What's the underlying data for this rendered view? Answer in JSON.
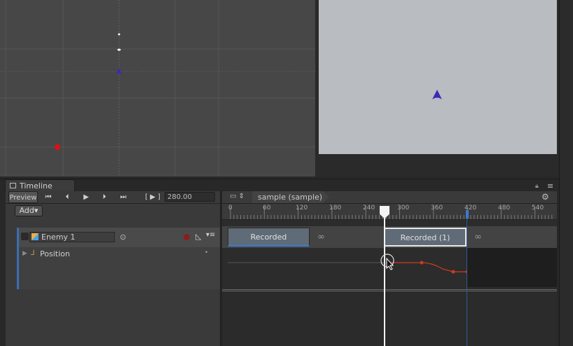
{
  "window": {
    "tab_label": "Timeline"
  },
  "toolbar": {
    "preview_label": "Preview",
    "frame_bracket": "[ ▶ ]",
    "time_value": "280.00",
    "add_label": "Add▾",
    "breadcrumb": "sample (sample)"
  },
  "ruler": {
    "ticks": [
      "0",
      "60",
      "120",
      "180",
      "240",
      "300",
      "360",
      "420",
      "480",
      "540"
    ]
  },
  "tracks": [
    {
      "binding_label": "Enemy 1",
      "sub_label": "Position",
      "clips": [
        {
          "label": "Recorded"
        },
        {
          "label": "Recorded (1)"
        }
      ]
    }
  ],
  "playhead_time": 280,
  "colors": {
    "accent": "#3a7bd0",
    "clip": "#5f6b76",
    "curve": "#d03a20",
    "enemy": "#3a2ab8",
    "marker": "#e01010"
  },
  "icons": [
    "timeline-icon",
    "skip-start-icon",
    "prev-frame-icon",
    "play-icon",
    "next-frame-icon",
    "skip-end-icon",
    "gear-icon",
    "lock-icon",
    "menu-icon",
    "infinity-icon",
    "record-icon",
    "curve-icon",
    "expand-arrow-icon",
    "target-icon"
  ]
}
